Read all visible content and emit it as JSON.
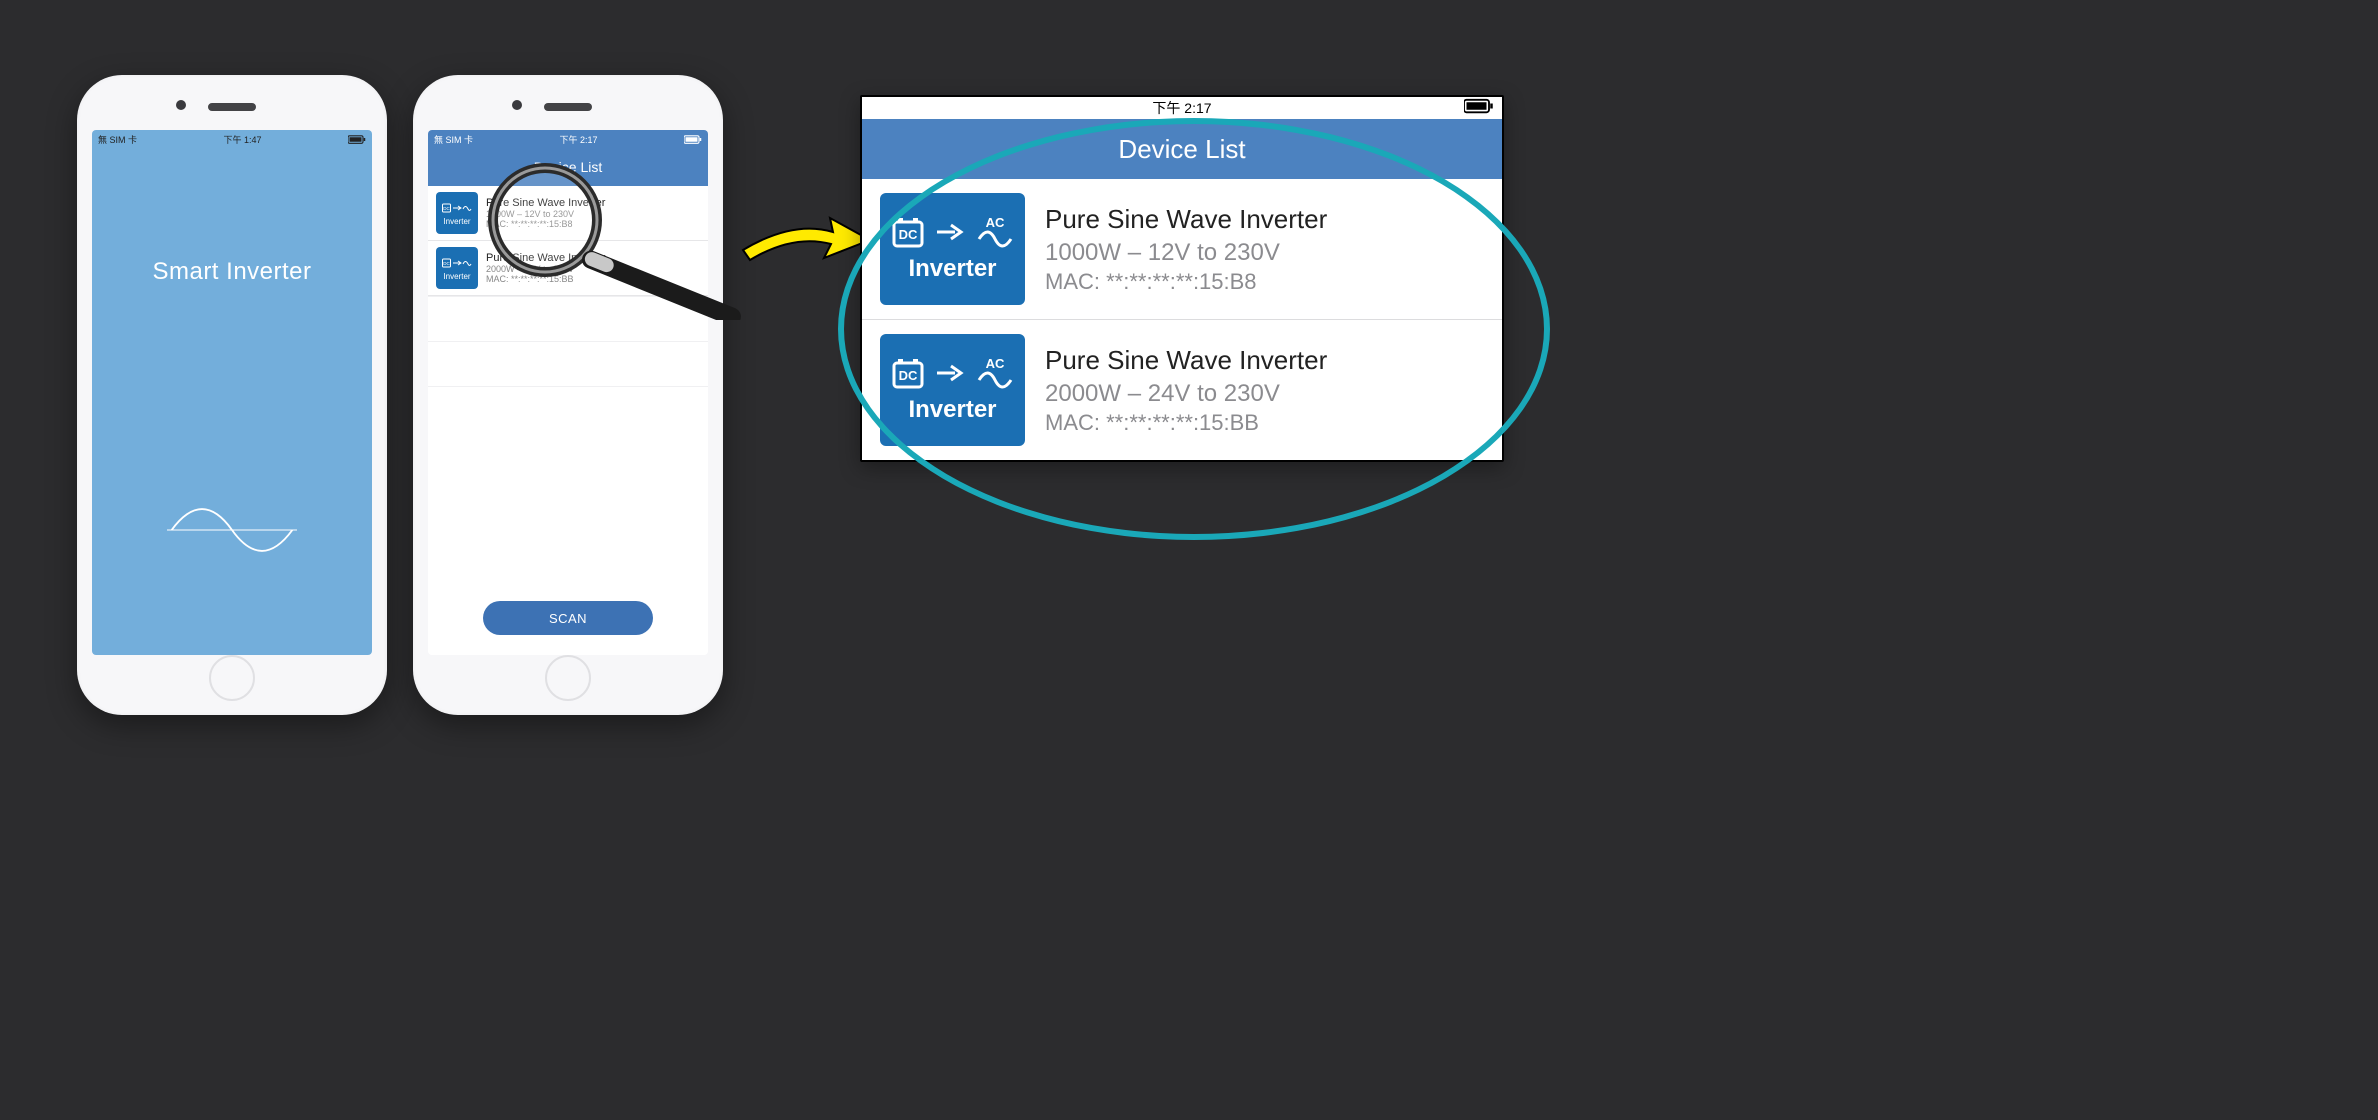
{
  "splash": {
    "carrier": "無 SIM 卡",
    "time": "下午 1:47",
    "app_title": "Smart Inverter"
  },
  "listScreen": {
    "carrier": "無 SIM 卡",
    "time": "下午 2:17",
    "nav_title": "Device List",
    "scan_label": "SCAN",
    "items": [
      {
        "title": "Pure Sine Wave Inverter",
        "spec": "1000W – 12V to 230V",
        "mac": "MAC: **:**:**:**:15:B8",
        "icon_label": "Inverter"
      },
      {
        "title": "Pure Sine Wave Inverter",
        "spec": "2000W – 24V to 230V",
        "mac": "MAC: **:**:**:**:15:BB",
        "icon_label": "Inverter"
      }
    ]
  },
  "zoom": {
    "time": "下午 2:17",
    "nav_title": "Device List",
    "icon_dc": "DC",
    "icon_ac": "AC",
    "icon_label": "Inverter"
  }
}
